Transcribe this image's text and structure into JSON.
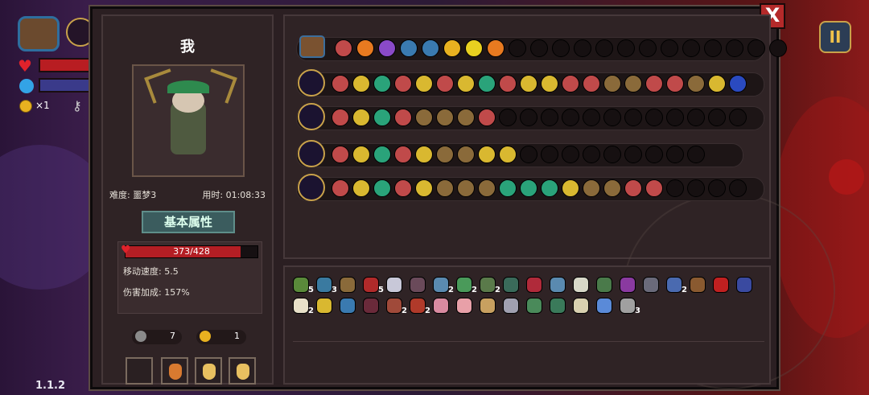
{
  "hud": {
    "coins_label": "×1",
    "version": "1.1.2",
    "pause_symbol": "II"
  },
  "dialog": {
    "close_symbol": "X",
    "player_name": "我",
    "difficulty": "难度: 噩梦3",
    "time_used": "用时: 01:08:33",
    "attributes_title": "基本属性",
    "hp_text": "373/428",
    "hp_fraction": 0.871,
    "move_speed": "移动速度: 5.5",
    "damage_bonus": "伤害加成: 157%",
    "keys": "7",
    "coins": "1"
  },
  "colors": {
    "gold": "#c9a24a",
    "hp_red": "#b41e24",
    "mp_blue": "#33a3e6",
    "attr_teal": "#3b5c5e"
  },
  "equip_icons": [
    "chest-icon",
    "whirl-icon",
    "radiation-icon",
    "orb-icon",
    "eye-icon",
    "eye-icon",
    "gold-flower-icon",
    "lightning-icon",
    "arrow-icon"
  ],
  "weapon_rows": [
    {
      "name": "staff-lightning",
      "filled": 21,
      "colors": [
        "#c04a4a",
        "#d9b830",
        "#2aa37a",
        "#c04a4a",
        "#d9b830",
        "#c04a4a",
        "#d9b830",
        "#2aa37a",
        "#c04a4a",
        "#d9b830",
        "#d9b830",
        "#c04a4a",
        "#c04a4a",
        "#8a6a3a",
        "#8a6a3a",
        "#c04a4a",
        "#c04a4a",
        "#8a6a3a",
        "#d9b830",
        "#2a4ac0",
        "#d97a30",
        "#2a4ac0",
        "#2a4ac0"
      ]
    },
    {
      "name": "staff-spark",
      "filled": 8,
      "colors": [
        "#c04a4a",
        "#d9b830",
        "#2aa37a",
        "#c04a4a",
        "#8a6a3a",
        "#8a6a3a",
        "#8a6a3a",
        "#c04a4a"
      ]
    },
    {
      "name": "gold-bomb",
      "filled": 9,
      "colors": [
        "#c04a4a",
        "#d9b830",
        "#2aa37a",
        "#c04a4a",
        "#d9b830",
        "#8a6a3a",
        "#8a6a3a",
        "#d9b830",
        "#d9b830"
      ]
    },
    {
      "name": "staff-blue",
      "filled": 16,
      "colors": [
        "#c04a4a",
        "#d9b830",
        "#2aa37a",
        "#c04a4a",
        "#d9b830",
        "#8a6a3a",
        "#8a6a3a",
        "#8a6a3a",
        "#2aa37a",
        "#2aa37a",
        "#2aa37a",
        "#d9b830",
        "#8a6a3a",
        "#8a6a3a",
        "#c04a4a",
        "#c04a4a"
      ]
    }
  ],
  "items_row1": [
    {
      "name": "vine-icon",
      "color": "#5a8a3a",
      "count": "5"
    },
    {
      "name": "magnifier-icon",
      "color": "#3a7aa0",
      "count": "3"
    },
    {
      "name": "lantern-icon",
      "color": "#8a6a3a",
      "count": ""
    },
    {
      "name": "demon-icon",
      "color": "#b02a2a",
      "count": "5"
    },
    {
      "name": "crystal-icon",
      "color": "#c8c8d8",
      "count": ""
    },
    {
      "name": "helmet-icon",
      "color": "#6a4a5a",
      "count": ""
    },
    {
      "name": "wings-icon",
      "color": "#5a8ab0",
      "count": "2"
    },
    {
      "name": "herb-icon",
      "color": "#4a9a5a",
      "count": "2"
    },
    {
      "name": "tome-icon",
      "color": "#5a7a4a",
      "count": "2"
    },
    {
      "name": "cloth-icon",
      "color": "#3a6a5a",
      "count": ""
    },
    {
      "name": "heart-icon",
      "color": "#b02a3a",
      "count": ""
    },
    {
      "name": "key-icon",
      "color": "#5a8ab0",
      "count": ""
    },
    {
      "name": "feather-icon",
      "color": "#d8d8c8",
      "count": ""
    },
    {
      "name": "hat-icon",
      "color": "#4a7a4a",
      "count": ""
    },
    {
      "name": "shield-icon",
      "color": "#8a3aa0",
      "count": ""
    },
    {
      "name": "bracer-icon",
      "color": "#6a6a7a",
      "count": ""
    },
    {
      "name": "scroll-icon",
      "color": "#4a6ab0",
      "count": "2"
    },
    {
      "name": "barrel-icon",
      "color": "#8a5a30",
      "count": ""
    },
    {
      "name": "clock-icon",
      "color": "#c02020",
      "count": ""
    },
    {
      "name": "gem-icon",
      "color": "#3a4aa0",
      "count": ""
    }
  ],
  "items_row2": [
    {
      "name": "claw-icon",
      "color": "#e8e0c8",
      "count": "2"
    },
    {
      "name": "chain-icon",
      "color": "#d9b830",
      "count": ""
    },
    {
      "name": "rune-icon",
      "color": "#3a7ab0",
      "count": ""
    },
    {
      "name": "mask-icon",
      "color": "#6a2a3a",
      "count": ""
    },
    {
      "name": "book-icon",
      "color": "#a04a3a",
      "count": "2"
    },
    {
      "name": "map-icon",
      "color": "#b03a2a",
      "count": "2"
    },
    {
      "name": "brain-icon",
      "color": "#d88aa0",
      "count": ""
    },
    {
      "name": "pig-icon",
      "color": "#e8a0a8",
      "count": ""
    },
    {
      "name": "parchment-icon",
      "color": "#c8a060",
      "count": ""
    },
    {
      "name": "glasses-icon",
      "color": "#a0a0b0",
      "count": ""
    },
    {
      "name": "glove-icon",
      "color": "#4a8a5a",
      "count": ""
    },
    {
      "name": "worm-icon",
      "color": "#3a7a5a",
      "count": ""
    },
    {
      "name": "pouch-icon",
      "color": "#d8d0b0",
      "count": ""
    },
    {
      "name": "egg-icon",
      "color": "#5a8ad8",
      "count": ""
    },
    {
      "name": "bone-icon",
      "color": "#a0a0a0",
      "count": "3"
    }
  ]
}
